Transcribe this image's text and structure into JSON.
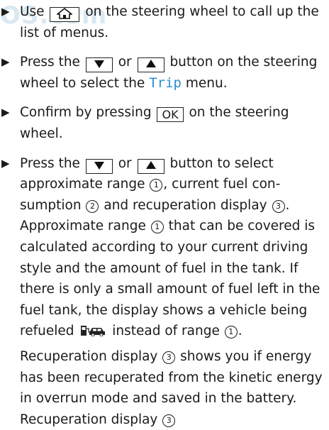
{
  "watermark": "OS.com",
  "steps": [
    {
      "before": "Use",
      "after": "on the steering wheel to call up the list of menus."
    },
    {
      "before": "Press the",
      "or": "or",
      "after_button": "button on the steer­ing wheel to select the",
      "menu": "Trip",
      "after": "menu."
    },
    {
      "before": "Confirm by pressing",
      "button": "OK",
      "after": "on the steering wheel."
    },
    {
      "before": "Press the",
      "or": "or",
      "after_button": "button to select approximate range",
      "c1": "1",
      "mid1": ", current fuel con­sumption",
      "c2": "2",
      "mid2": "and recuperation display",
      "c3": "3",
      "end": ".",
      "p1_start": "Approximate range",
      "p1_c": "1",
      "p1_rest": "that can be covered is calculated according to your current driv­ing style and the amount of fuel in the tank. If there is only a small amount of fuel left in the fuel tank, the display shows a vehicle being refueled",
      "p1_after": "instead of range",
      "p1_c2": "1",
      "p1_end": ".",
      "p2_start": "Recuperation display",
      "p2_c": "3",
      "p2_rest": "shows you if energy has been recuperated from the kinetic energy in overrun mode and saved in the battery. Recuperation display",
      "p2_c2": "3"
    }
  ],
  "icons": {
    "home": "home-icon",
    "down": "triangle-down-icon",
    "up": "triangle-up-icon",
    "refuel": "vehicle-refuel-icon",
    "bullet": "triangle-bullet-icon"
  },
  "colors": {
    "menu_text": "#2b8fd0",
    "watermark": "#d9e8f1"
  }
}
